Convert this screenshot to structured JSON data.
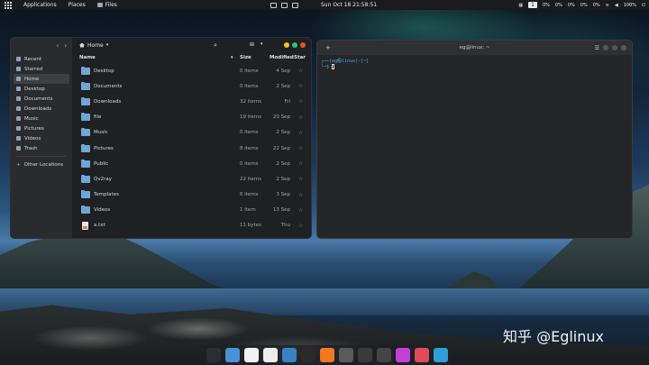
{
  "topbar": {
    "applications": "Applications",
    "places": "Places",
    "files": "Files",
    "clock": "Sun Oct 18  21:58:51",
    "workspace": "1",
    "indicators": [
      "0%",
      "0%",
      "0%",
      "0%",
      "0%",
      "100%"
    ]
  },
  "sidebar": {
    "items": [
      {
        "label": "Recent",
        "icon": "clock-icon"
      },
      {
        "label": "Starred",
        "icon": "star-icon"
      },
      {
        "label": "Home",
        "icon": "home-icon"
      },
      {
        "label": "Desktop",
        "icon": "desktop-icon"
      },
      {
        "label": "Documents",
        "icon": "documents-icon"
      },
      {
        "label": "Downloads",
        "icon": "downloads-icon"
      },
      {
        "label": "Music",
        "icon": "music-icon"
      },
      {
        "label": "Pictures",
        "icon": "pictures-icon"
      },
      {
        "label": "Videos",
        "icon": "videos-icon"
      },
      {
        "label": "Trash",
        "icon": "trash-icon"
      },
      {
        "label": "Other Locations",
        "icon": "plus-icon"
      }
    ]
  },
  "files": {
    "location": "Home",
    "columns": {
      "name": "Name",
      "size": "Size",
      "modified": "Modified",
      "star": "Star"
    },
    "rows": [
      {
        "name": "Desktop",
        "size": "0 items",
        "modified": "4 Sep",
        "type": "folder"
      },
      {
        "name": "Documents",
        "size": "0 items",
        "modified": "2 Sep",
        "type": "folder"
      },
      {
        "name": "Downloads",
        "size": "32 items",
        "modified": "Fri",
        "type": "folder"
      },
      {
        "name": "file",
        "size": "19 items",
        "modified": "20 Sep",
        "type": "folder"
      },
      {
        "name": "Music",
        "size": "0 items",
        "modified": "2 Sep",
        "type": "folder"
      },
      {
        "name": "Pictures",
        "size": "8 items",
        "modified": "22 Sep",
        "type": "folder"
      },
      {
        "name": "Public",
        "size": "0 items",
        "modified": "2 Sep",
        "type": "folder"
      },
      {
        "name": "Qv2ray",
        "size": "22 items",
        "modified": "2 Sep",
        "type": "folder"
      },
      {
        "name": "Templates",
        "size": "6 items",
        "modified": "3 Sep",
        "type": "folder"
      },
      {
        "name": "Videos",
        "size": "1 item",
        "modified": "13 Sep",
        "type": "folder"
      },
      {
        "name": "a.txt",
        "size": "11 bytes",
        "modified": "Thu",
        "type": "text"
      }
    ]
  },
  "terminal": {
    "title": "eg@linux: ~",
    "line1": "┌──(eg㉿linux)-[~]",
    "line2": "└─$ "
  },
  "watermark": "知乎 @Eglinux",
  "colors": {
    "folder": "#6ea7d8",
    "close_dot": "#e95420",
    "min_dot": "#f5c211",
    "max_dot": "#2ec27e",
    "terminal_prompt": "#4fa3e8"
  },
  "dock": [
    "activity-icon",
    "finder-icon",
    "chrome-icon",
    "editor-icon",
    "vscode-icon",
    "terminal-icon",
    "firefox-icon",
    "audio-icon",
    "network-icon",
    "shell-icon",
    "paint-icon",
    "app-icon",
    "vm-icon"
  ]
}
